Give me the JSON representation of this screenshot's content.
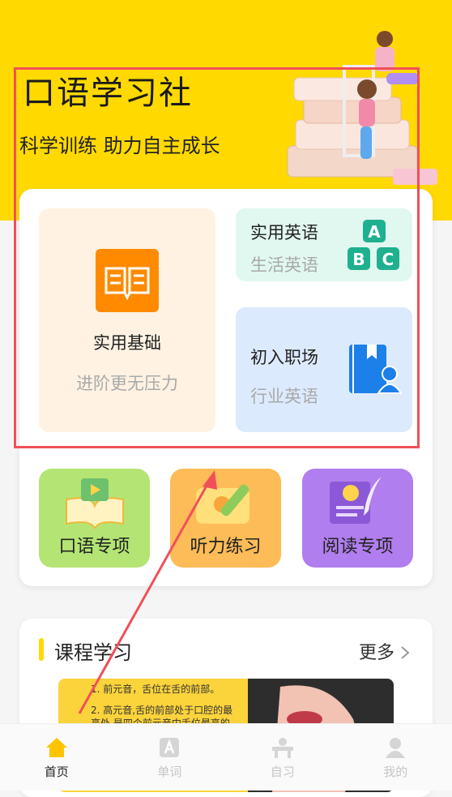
{
  "header": {
    "title": "口语学习社",
    "subtitle": "科学训练  助力自主成长"
  },
  "feature_tiles": [
    {
      "name": "实用基础",
      "subtitle": "进阶更无压力"
    },
    {
      "name": "实用英语",
      "subtitle": "生活英语",
      "badge_letters": [
        "A",
        "B",
        "C"
      ]
    },
    {
      "name": "初入职场",
      "subtitle": "行业英语"
    }
  ],
  "shortcuts": [
    {
      "label": "口语专项",
      "color": "#b4e574"
    },
    {
      "label": "听力练习",
      "color": "#fdbc57"
    },
    {
      "label": "阅读专项",
      "color": "#b07eee"
    }
  ],
  "course": {
    "title": "课程学习",
    "more_label": "更多",
    "banner_lines": [
      "1. 前元音，舌位在舌的前部。",
      "2. 高元音,舌的前部处于口腔的最",
      "高处,是四个前元音中舌位最高的"
    ]
  },
  "tabbar": {
    "items": [
      {
        "label": "首页",
        "active": true
      },
      {
        "label": "单词",
        "active": false
      },
      {
        "label": "自习",
        "active": false
      },
      {
        "label": "我的",
        "active": false
      }
    ]
  },
  "colors": {
    "hero_bg": "#ffd900",
    "annotation": "#f0505a",
    "icon_orange": "#ff8a00",
    "icon_green": "#1fb08f",
    "icon_blue": "#1d7fe8"
  }
}
